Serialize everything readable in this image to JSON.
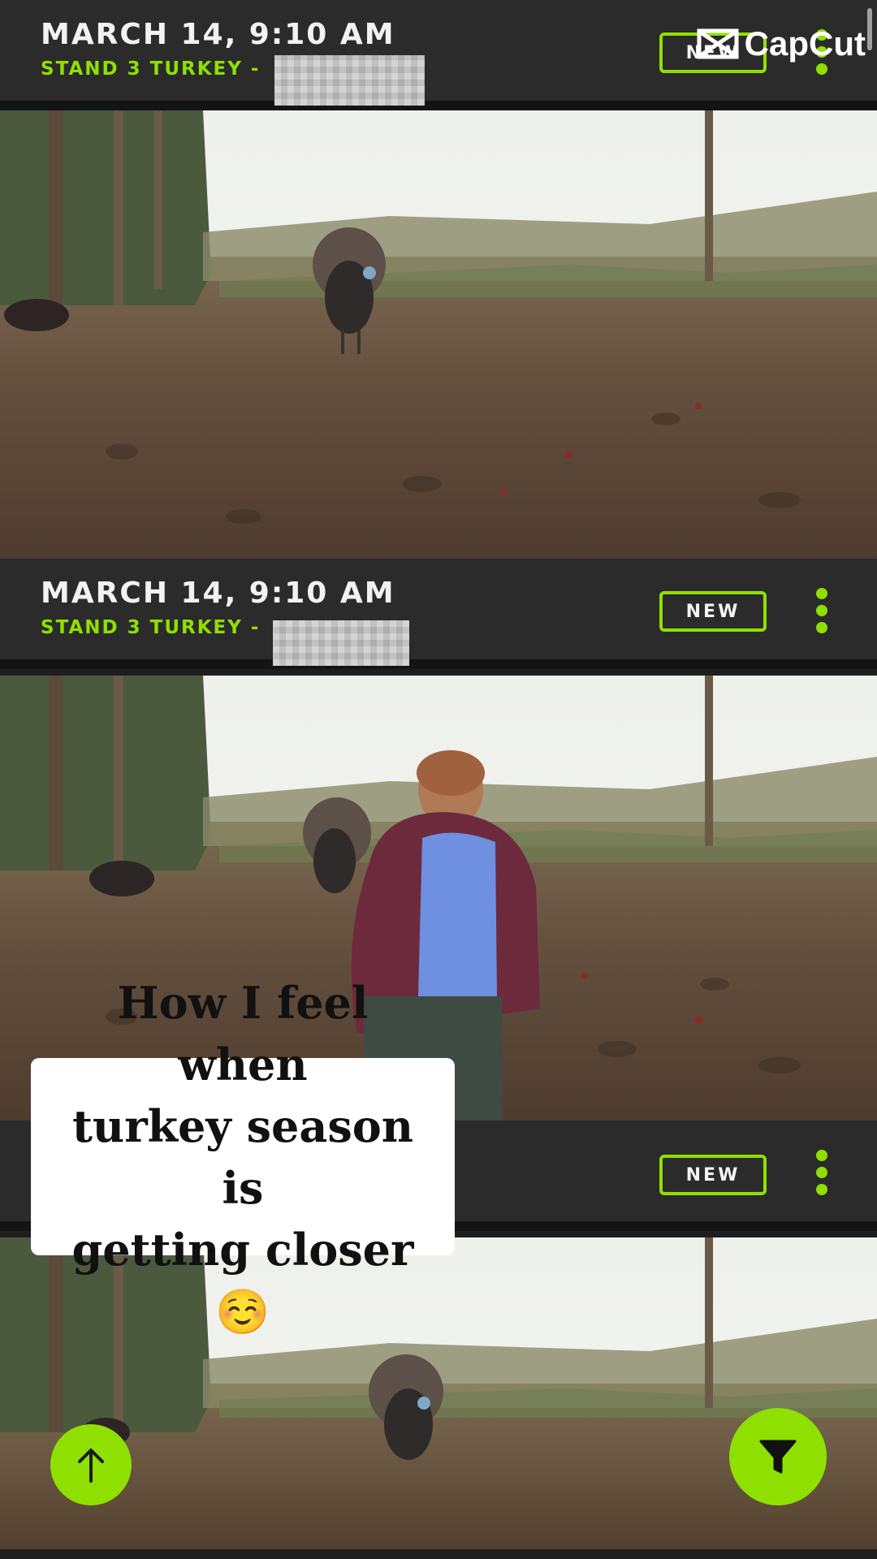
{
  "watermark": {
    "text": "CapCut"
  },
  "cards": [
    {
      "date": "MARCH 14, 9:10 AM",
      "subtitle": "STAND 3 TURKEY -",
      "badge": "NEW"
    },
    {
      "date": "MARCH 14, 9:10 AM",
      "subtitle": "STAND 3 TURKEY -",
      "badge": "NEW"
    },
    {
      "badge": "NEW"
    }
  ],
  "caption": {
    "line1": "How I feel when",
    "line2": "turkey season is",
    "line3": "getting closer ☺️"
  },
  "colors": {
    "accent": "#8fe000",
    "header_bg": "#2b2b2b",
    "separator": "#141414"
  },
  "icons": {
    "scroll_top": "arrow-up-icon",
    "filter": "filter-funnel-icon",
    "menu": "kebab-menu-icon"
  }
}
